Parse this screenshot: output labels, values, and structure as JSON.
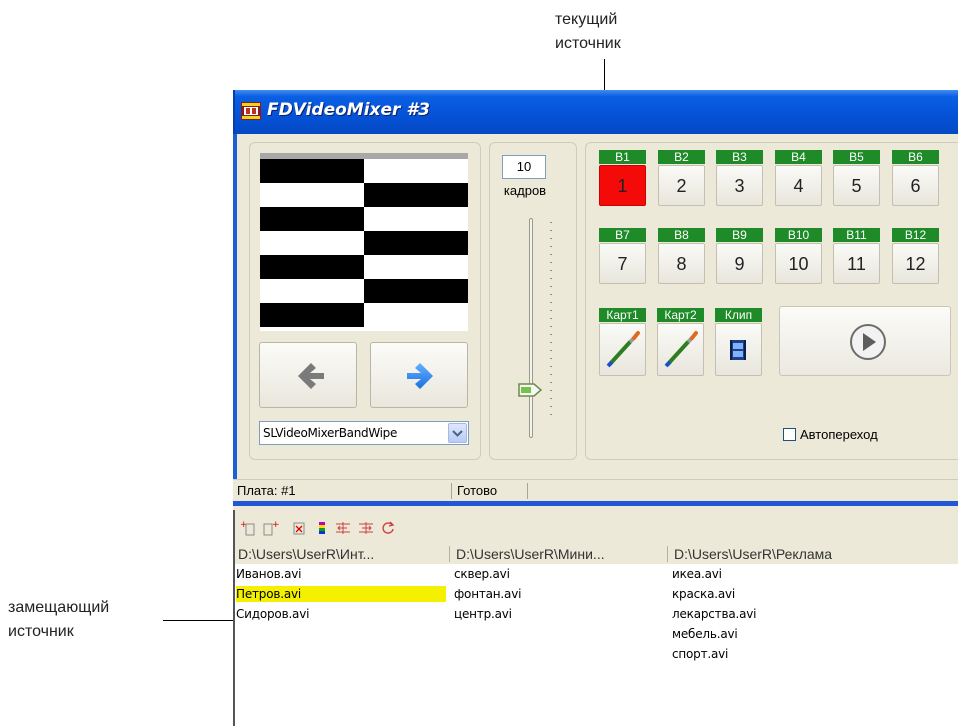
{
  "annotations": {
    "current_source": [
      "текущий",
      "источник"
    ],
    "replacement_source": [
      "замещающий",
      "источник"
    ]
  },
  "window": {
    "title": "FDVideoMixer #3"
  },
  "transition": {
    "frames_value": "10",
    "frames_label": "кадров",
    "effect_selected": "SLVideoMixerBandWipe",
    "frames_slider_level": 0.1
  },
  "sources": [
    {
      "label": "B1",
      "number": "1",
      "active": true
    },
    {
      "label": "B2",
      "number": "2",
      "active": false
    },
    {
      "label": "B3",
      "number": "3",
      "active": false
    },
    {
      "label": "B4",
      "number": "4",
      "active": false
    },
    {
      "label": "B5",
      "number": "5",
      "active": false
    },
    {
      "label": "B6",
      "number": "6",
      "active": false
    },
    {
      "label": "B7",
      "number": "7",
      "active": false
    },
    {
      "label": "B8",
      "number": "8",
      "active": false
    },
    {
      "label": "B9",
      "number": "9",
      "active": false
    },
    {
      "label": "B10",
      "number": "10",
      "active": false
    },
    {
      "label": "B11",
      "number": "11",
      "active": false
    },
    {
      "label": "B12",
      "number": "12",
      "active": false
    }
  ],
  "extra_sources": [
    {
      "label": "Карт1",
      "icon": "brush-icon"
    },
    {
      "label": "Карт2",
      "icon": "brush-icon"
    },
    {
      "label": "Клип",
      "icon": "film-icon"
    }
  ],
  "auto_transition": {
    "label": "Автопереход",
    "checked": false
  },
  "status": {
    "board": "Плата: #1",
    "state": "Готово"
  },
  "playlists": {
    "columns": [
      {
        "header": "D:\\Users\\UserR\\Инт...",
        "files": [
          "Иванов.avi",
          "Петров.avi",
          "Сидоров.avi"
        ],
        "highlighted": 1
      },
      {
        "header": "D:\\Users\\UserR\\Мини...",
        "files": [
          "сквер.avi",
          "фонтан.avi",
          "центр.avi"
        ],
        "highlighted": -1
      },
      {
        "header": "D:\\Users\\UserR\\Реклама",
        "files": [
          "икеа.avi",
          "краска.avi",
          "лекарства.avi",
          "мебель.avi",
          "спорт.avi"
        ],
        "highlighted": -1
      }
    ]
  },
  "colors": {
    "active_source": "#f50a0a",
    "source_label_bg": "#1e8a28",
    "highlight": "#f4f000",
    "titlebar": "#0553d8"
  }
}
